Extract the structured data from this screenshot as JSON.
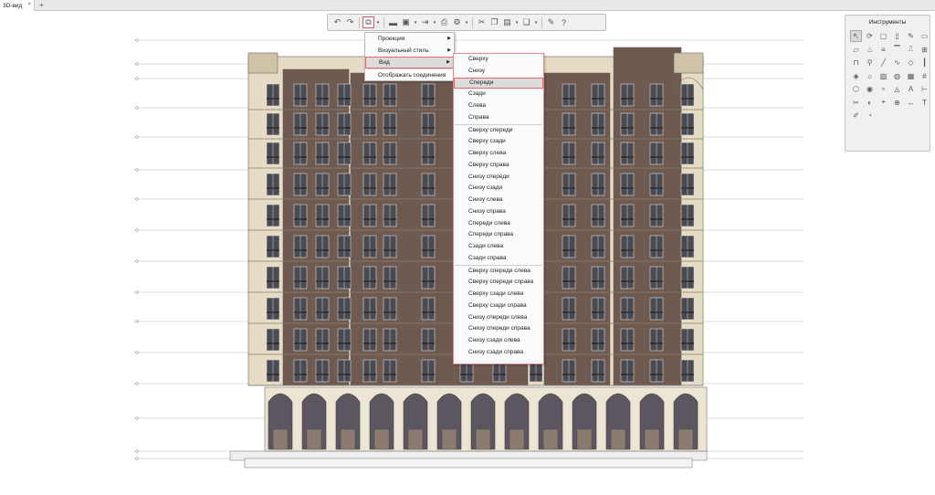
{
  "tabbar": {
    "active_tab": "3D-вид",
    "close_glyph": "×",
    "add_glyph": "+"
  },
  "toolbar": {
    "items": [
      {
        "name": "undo-icon",
        "glyph": "↶"
      },
      {
        "name": "redo-icon",
        "glyph": "↷"
      },
      {
        "name": "view-icon",
        "glyph": "⧉",
        "active": true
      },
      {
        "name": "folder-icon",
        "glyph": "▬"
      },
      {
        "name": "save-icon",
        "glyph": "▣"
      },
      {
        "name": "export-icon",
        "glyph": "⇥"
      },
      {
        "name": "print-icon",
        "glyph": "⎙"
      },
      {
        "name": "settings-icon",
        "glyph": "⚙"
      },
      {
        "name": "cut-icon",
        "glyph": "✂"
      },
      {
        "name": "copy-icon",
        "glyph": "❐"
      },
      {
        "name": "paste-icon",
        "glyph": "▤"
      },
      {
        "name": "layers-icon",
        "glyph": "❏"
      },
      {
        "name": "wrench-icon",
        "glyph": "✎"
      },
      {
        "name": "help-icon",
        "glyph": "?"
      }
    ],
    "dropdown_glyph": "▾"
  },
  "main_menu": {
    "items": [
      {
        "label": "Проекция",
        "submenu": true
      },
      {
        "label": "Визуальный стиль",
        "submenu": true
      },
      {
        "label": "Вид",
        "submenu": true,
        "highlighted": true
      },
      {
        "label": "Отображать соединения",
        "submenu": false
      }
    ],
    "submenu_glyph": "▶"
  },
  "view_submenu": {
    "groups": [
      [
        "Сверху",
        "Снизу",
        "Спереди",
        "Сзади",
        "Слева",
        "Справа"
      ],
      [
        "Сверху спереди",
        "Сверху сзади",
        "Сверху слева",
        "Сверху справа",
        "Снизу спереди",
        "Снизу сзади",
        "Снизу слева",
        "Снизу справа",
        "Спереди слева",
        "Спереди справа",
        "Сзади слева",
        "Сзади справа"
      ],
      [
        "Сверху спереди слева",
        "Сверху спереди справа",
        "Сверху сзади слева",
        "Сверху сзади справа",
        "Снизу спереди слева",
        "Снизу спереди справа",
        "Снизу сзади слева",
        "Снизу сзади справа"
      ]
    ],
    "highlighted": "Спереди"
  },
  "tools_panel": {
    "title": "Инструменты",
    "tools": [
      "select-icon",
      "rotate-icon",
      "rectangle-icon",
      "column-icon",
      "pencil-icon",
      "wall-icon",
      "slab-icon",
      "roof-icon",
      "stair-icon",
      "beam-icon",
      "door-icon",
      "window-icon",
      "table-icon",
      "object-icon",
      "line-icon",
      "curve-icon",
      "poly-icon",
      "pipe-icon",
      "shape-icon",
      "lamp-icon",
      "hatch-icon",
      "paint-icon",
      "zone-icon",
      "grid-icon",
      "mesh-icon",
      "camera-icon",
      "node-icon",
      "label-icon",
      "text-icon",
      "measure-icon",
      "cut-icon",
      "section-icon",
      "elevation-icon",
      "detail-icon",
      "dimension-icon",
      "text-tool-icon",
      "pen-icon",
      "marker-icon"
    ],
    "tool_glyphs": [
      "↖",
      "⟳",
      "▢",
      "▯",
      "✎",
      "▭",
      "▱",
      "⌂",
      "≡",
      "▔",
      "⎍",
      "⊞",
      "⊓",
      "⚲",
      "╱",
      "∿",
      "◇",
      "┃",
      "◈",
      "☼",
      "▨",
      "◍",
      "▦",
      "#",
      "⬡",
      "◉",
      "∘",
      "◬",
      "A",
      "⊢",
      "✂",
      "◐",
      "⌖",
      "⊕",
      "↔",
      "T",
      "✐",
      "◔"
    ],
    "selected_tool": "select-icon"
  },
  "colors": {
    "brick": "#6f5a52",
    "brick_dark": "#5a4842",
    "stucco": "#e6dcc6",
    "stucco_trim": "#cfc3a8",
    "window_glass": "#4a4a52",
    "accent_highlight": "#e06a6a"
  }
}
